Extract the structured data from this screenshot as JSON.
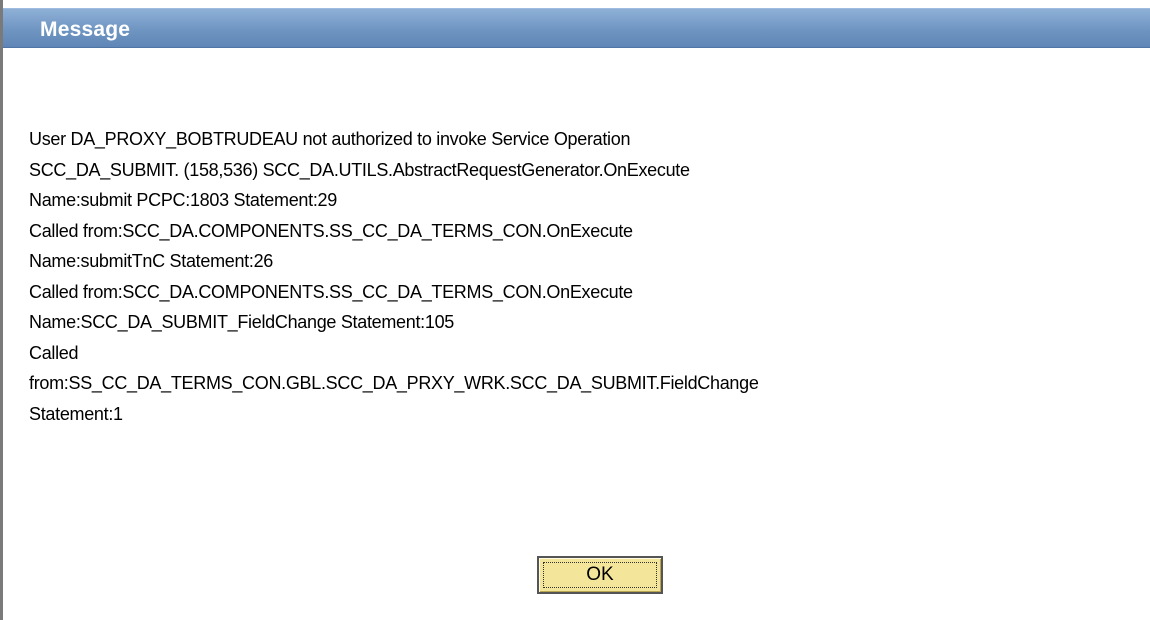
{
  "dialog": {
    "title": "Message",
    "lines": [
      "User DA_PROXY_BOBTRUDEAU not authorized to invoke Service Operation",
      "SCC_DA_SUBMIT. (158,536) SCC_DA.UTILS.AbstractRequestGenerator.OnExecute",
      "Name:submit  PCPC:1803  Statement:29",
      "Called from:SCC_DA.COMPONENTS.SS_CC_DA_TERMS_CON.OnExecute",
      "Name:submitTnC  Statement:26",
      "Called from:SCC_DA.COMPONENTS.SS_CC_DA_TERMS_CON.OnExecute",
      "Name:SCC_DA_SUBMIT_FieldChange  Statement:105",
      "Called",
      "from:SS_CC_DA_TERMS_CON.GBL.SCC_DA_PRXY_WRK.SCC_DA_SUBMIT.FieldChange",
      "Statement:1"
    ],
    "ok_label": "OK"
  },
  "colors": {
    "titlebar": "#6f95c2",
    "button": "#f3e59a"
  }
}
